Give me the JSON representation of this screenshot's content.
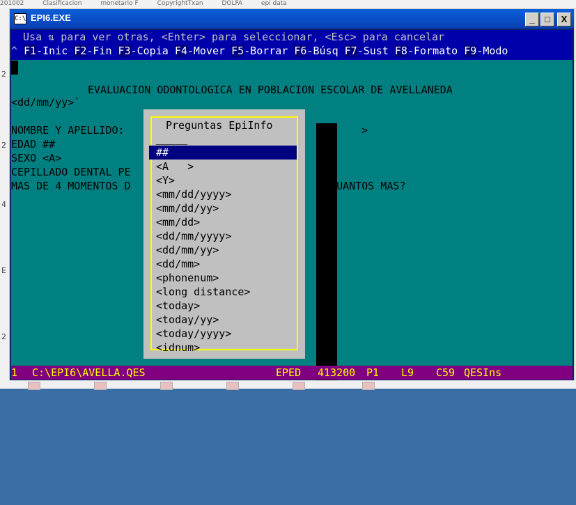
{
  "window": {
    "title": "EPI6.EXE",
    "icon_label": "C:\\",
    "controls": {
      "minimize": "_",
      "maximize": "□",
      "close": "X"
    }
  },
  "desktop": {
    "top_labels": [
      "201002",
      "Clasificacion",
      "monetario F",
      "CopyrightTxan",
      "DOLFA",
      "epi data"
    ],
    "left_labels": [
      "2",
      "2",
      "4",
      "E",
      "2"
    ]
  },
  "hint_bar": {
    "text": " Usa ⇅ para ver otras, <Enter> para seleccionar, <Esc> para cancelar"
  },
  "function_keys": {
    "prefix": "^ ",
    "items": [
      {
        "key": "F1",
        "label": "-Inic "
      },
      {
        "key": "F2",
        "label": "-Fin "
      },
      {
        "key": "F3",
        "label": "-Copia "
      },
      {
        "key": "F4",
        "label": "-Mover "
      },
      {
        "key": "F5",
        "label": "-Borrar "
      },
      {
        "key": "F6",
        "label": "-Búsq "
      },
      {
        "key": "F7",
        "label": "-Sust "
      },
      {
        "key": "F8",
        "label": "-Formato "
      },
      {
        "key": "F9",
        "label": "-Modo"
      }
    ]
  },
  "document": {
    "heading": "EVALUACION ODONTOLOGICA EN POBLACION ESCOLAR DE AVELLANEDA",
    "date_field": "<dd/mm/yy>`",
    "line_nombre": "NOMBRE Y APELLIDO:",
    "line_edad": "EDAD ##",
    "line_sexo": "SEXO <A>",
    "line_cepillado": "CEPILLADO DENTAL PE",
    "line_momentos": "MAS DE 4 MOMENTOS D",
    "momentos_tail": "> CUANTOS MAS?",
    "field_close": ">"
  },
  "menu": {
    "title": "Preguntas EpiInfo",
    "items": [
      "_____",
      "##",
      "<A   >",
      "<Y>",
      "<mm/dd/yyyy>",
      "<mm/dd/yy>",
      "<mm/dd>",
      "<dd/mm/yyyy>",
      "<dd/mm/yy>",
      "<dd/mm>",
      "<phonenum>",
      "<long distance>",
      "<today>",
      "<today/yy>",
      "<today/yyyy>",
      "<idnum>"
    ],
    "selected_index": 1
  },
  "status_bar": {
    "line": "1",
    "file": "C:\\EPI6\\AVELLA.QES",
    "mode": "EPED",
    "memory": "413200",
    "page": "P1",
    "row": "L9",
    "col": "C59",
    "state": "QESIns"
  },
  "colors": {
    "screen_bg": "#008080",
    "bar_bg": "#0000aa",
    "menu_frame": "#ffff00",
    "status_bg": "#800080",
    "status_fg": "#ffff00",
    "selection": "#000080"
  }
}
